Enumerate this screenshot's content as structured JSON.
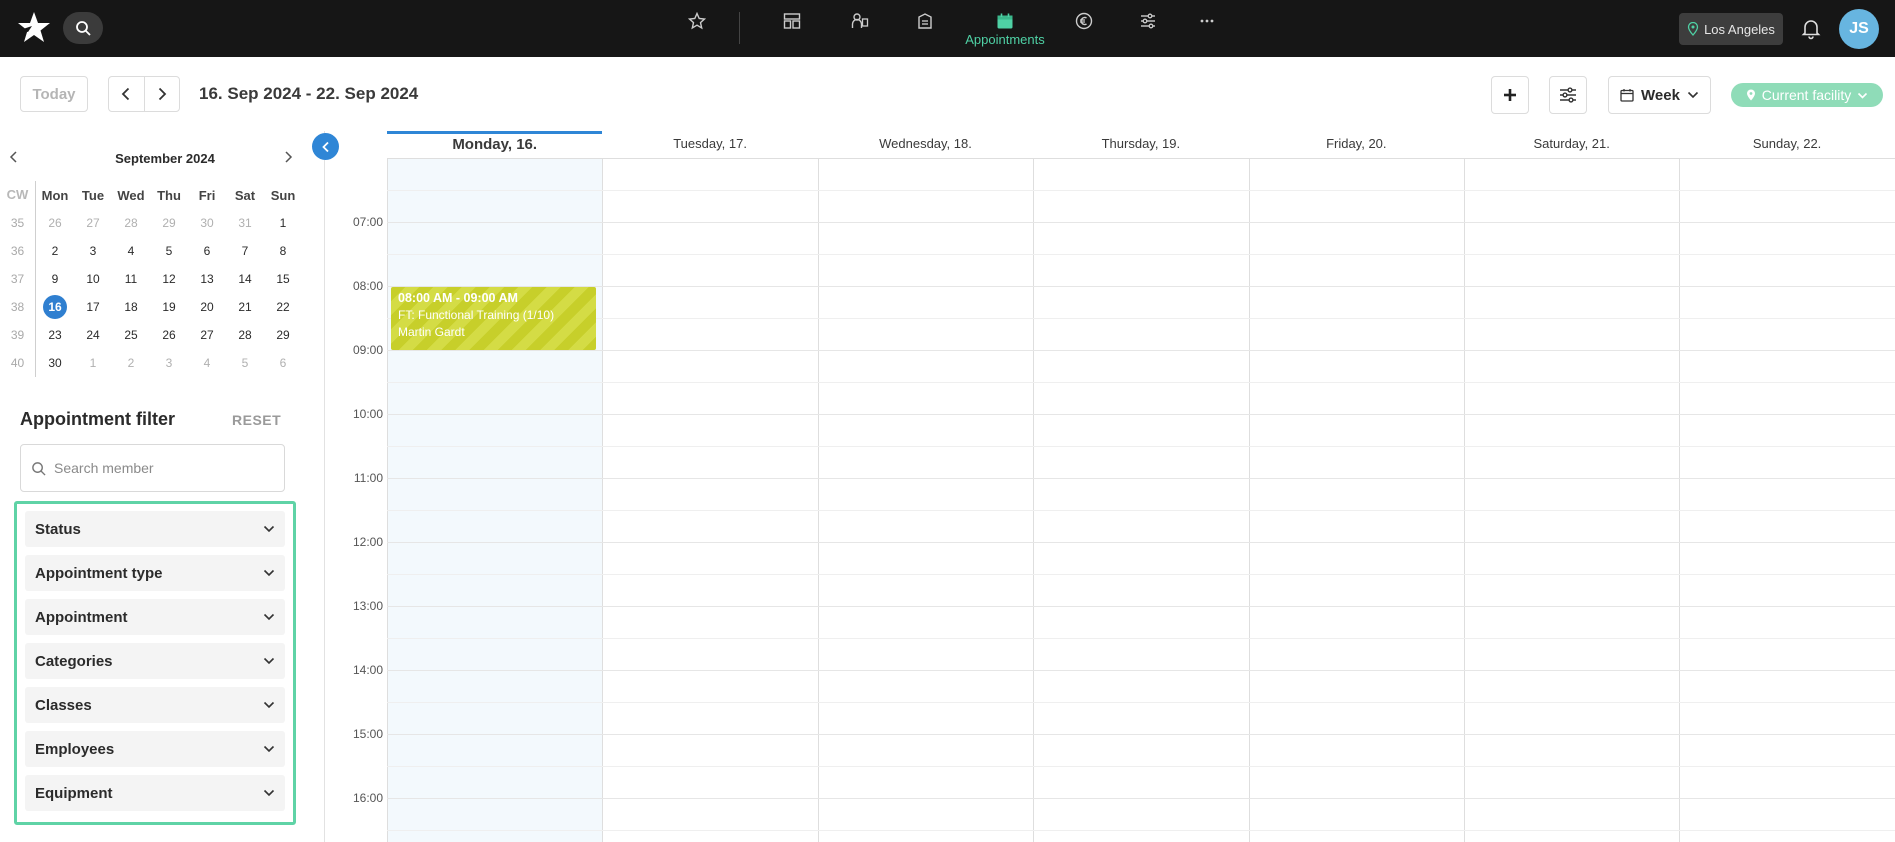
{
  "topbar": {
    "nav_active_label": "Appointments",
    "location_label": "Los Angeles",
    "avatar_initials": "JS",
    "accent_color": "#4fd1a5"
  },
  "toolbar": {
    "today_label": "Today",
    "date_range": "16. Sep 2024 - 22. Sep 2024",
    "view_label": "Week",
    "facility_label": "Current facility"
  },
  "mini_calendar": {
    "title": "September 2024",
    "headers": [
      "CW",
      "Mon",
      "Tue",
      "Wed",
      "Thu",
      "Fri",
      "Sat",
      "Sun"
    ],
    "weeks": [
      {
        "cw": "35",
        "days": [
          "26",
          "27",
          "28",
          "29",
          "30",
          "31",
          "1"
        ]
      },
      {
        "cw": "36",
        "days": [
          "2",
          "3",
          "4",
          "5",
          "6",
          "7",
          "8"
        ]
      },
      {
        "cw": "37",
        "days": [
          "9",
          "10",
          "11",
          "12",
          "13",
          "14",
          "15"
        ]
      },
      {
        "cw": "38",
        "days": [
          "16",
          "17",
          "18",
          "19",
          "20",
          "21",
          "22"
        ]
      },
      {
        "cw": "39",
        "days": [
          "23",
          "24",
          "25",
          "26",
          "27",
          "28",
          "29"
        ]
      },
      {
        "cw": "40",
        "days": [
          "30",
          "1",
          "2",
          "3",
          "4",
          "5",
          "6"
        ]
      }
    ],
    "selected": "16"
  },
  "filter": {
    "title": "Appointment filter",
    "reset_label": "RESET",
    "search_placeholder": "Search member",
    "items": [
      "Status",
      "Appointment type",
      "Appointment",
      "Categories",
      "Classes",
      "Employees",
      "Equipment"
    ]
  },
  "calendar": {
    "days": [
      "Monday, 16.",
      "Tuesday, 17.",
      "Wednesday, 18.",
      "Thursday, 19.",
      "Friday, 20.",
      "Saturday, 21.",
      "Sunday, 22."
    ],
    "times": [
      "07:00",
      "08:00",
      "09:00",
      "10:00",
      "11:00",
      "12:00",
      "13:00",
      "14:00",
      "15:00",
      "16:00"
    ]
  },
  "event": {
    "time": "08:00 AM - 09:00 AM",
    "title": "FT: Functional Training (1/10)",
    "person": "Martin Gardt"
  }
}
